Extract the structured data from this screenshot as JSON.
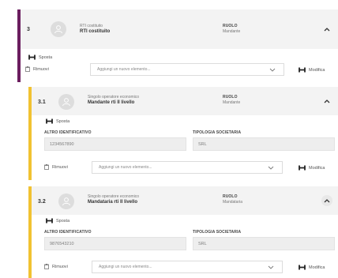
{
  "colors": {
    "purple": "#6b1e5f",
    "yellow": "#f1c232"
  },
  "groups": [
    {
      "num": "3",
      "subtitle": "RTI costituito",
      "title": "RTI costituito",
      "ruolo_label": "RUOLO",
      "ruolo_value": "Mandante",
      "sposta": "Sposta",
      "rimuovi": "Rimuovi",
      "select_placeholder": "Aggiungi un nuovo elemento...",
      "modifica": "Modifica"
    },
    {
      "num": "3.1",
      "subtitle": "Singolo operatore economico",
      "title": "Mandante rti II livello",
      "ruolo_label": "RUOLO",
      "ruolo_value": "Mandante",
      "sposta": "Sposta",
      "altro_label": "ALTRO IDENTIFICATIVO",
      "altro_value": "1234567890",
      "tipologia_label": "TIPOLOGIA SOCIETARIA",
      "tipologia_value": "SRL",
      "rimuovi": "Rimuovi",
      "select_placeholder": "Aggiungi un nuovo elemento...",
      "modifica": "Modifica"
    },
    {
      "num": "3.2",
      "subtitle": "Singolo operatore economico",
      "title": "Mandataria rti II livello",
      "ruolo_label": "RUOLO",
      "ruolo_value": "Mandataria",
      "sposta": "Sposta",
      "altro_label": "ALTRO IDENTIFICATIVO",
      "altro_value": "9876543210",
      "tipologia_label": "TIPOLOGIA SOCIETARIA",
      "tipologia_value": "SRL",
      "rimuovi": "Rimuovi",
      "select_placeholder": "Aggiungi un nuovo elemento...",
      "modifica": "Modifica"
    }
  ]
}
